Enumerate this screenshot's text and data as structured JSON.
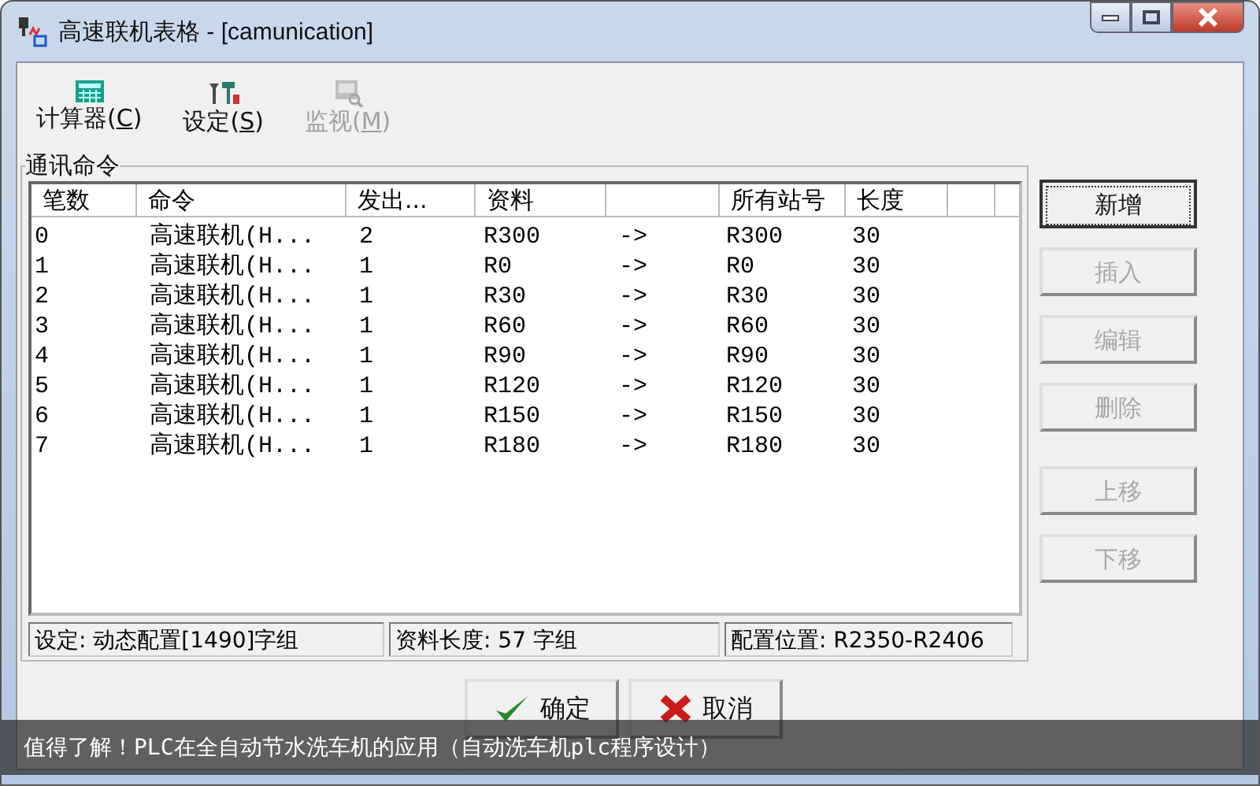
{
  "window": {
    "title": "高速联机表格 - [camunication]"
  },
  "toolbar": [
    {
      "label": "计算器(",
      "mnemonic": "C",
      "suffix": ")",
      "kind": "calculator",
      "disabled": false
    },
    {
      "label": "设定(",
      "mnemonic": "S",
      "suffix": ")",
      "kind": "settings",
      "disabled": false
    },
    {
      "label": "监视(",
      "mnemonic": "M",
      "suffix": ")",
      "kind": "monitor",
      "disabled": true
    }
  ],
  "group": {
    "title": "通讯命令"
  },
  "table": {
    "columns": [
      {
        "kind": "text",
        "label": "笔数"
      },
      {
        "kind": "text",
        "label": "命令"
      },
      {
        "kind": "text",
        "label": "发出..."
      },
      {
        "kind": "text",
        "label": "资料"
      },
      {
        "kind": "blank"
      },
      {
        "kind": "text",
        "label": "所有站号"
      },
      {
        "kind": "text",
        "label": "长度"
      },
      {
        "kind": "blank"
      }
    ],
    "rows": [
      [
        "0",
        "高速联机(H...",
        "2",
        "R300",
        "->",
        "R300",
        "30"
      ],
      [
        "1",
        "高速联机(H...",
        "1",
        "R0",
        "->",
        "R0",
        "30"
      ],
      [
        "2",
        "高速联机(H...",
        "1",
        "R30",
        "->",
        "R30",
        "30"
      ],
      [
        "3",
        "高速联机(H...",
        "1",
        "R60",
        "->",
        "R60",
        "30"
      ],
      [
        "4",
        "高速联机(H...",
        "1",
        "R90",
        "->",
        "R90",
        "30"
      ],
      [
        "5",
        "高速联机(H...",
        "1",
        "R120",
        "->",
        "R120",
        "30"
      ],
      [
        "6",
        "高速联机(H...",
        "1",
        "R150",
        "->",
        "R150",
        "30"
      ],
      [
        "7",
        "高速联机(H...",
        "1",
        "R180",
        "->",
        "R180",
        "30"
      ]
    ]
  },
  "status_bar": [
    "设定: 动态配置[1490]字组",
    "资料长度: 57 字组",
    "配置位置: R2350-R2406"
  ],
  "side_buttons": [
    {
      "label": "新增",
      "disabled": false,
      "focused": true
    },
    {
      "label": "插入",
      "disabled": true,
      "focused": false
    },
    {
      "label": "编辑",
      "disabled": true,
      "focused": false
    },
    {
      "label": "删除",
      "disabled": true,
      "focused": false
    },
    {
      "label": "上移",
      "disabled": true,
      "focused": false
    },
    {
      "label": "下移",
      "disabled": true,
      "focused": false
    }
  ],
  "dialog_buttons": [
    {
      "label": "确定",
      "kind": "ok"
    },
    {
      "label": "取消",
      "kind": "cancel"
    }
  ],
  "caption": "值得了解！PLC在全自动节水洗车机的应用（自动洗车机plc程序设计）"
}
